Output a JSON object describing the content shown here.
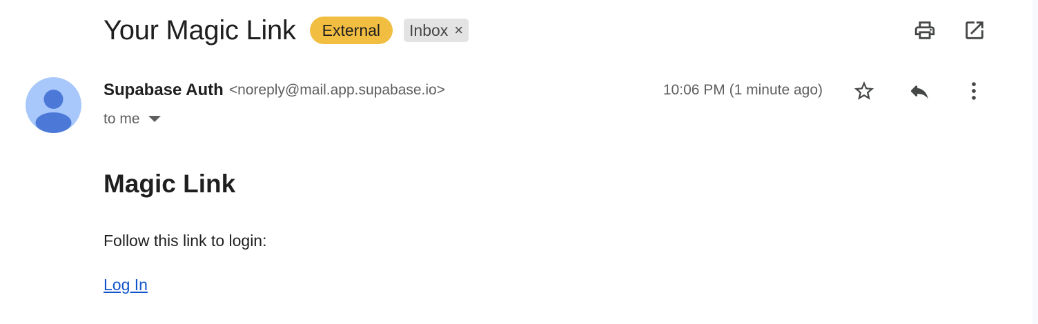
{
  "email": {
    "subject": "Your Magic Link",
    "labels": {
      "external": "External",
      "inbox": "Inbox",
      "remove_symbol": "×"
    },
    "sender": {
      "name": "Supabase Auth",
      "email": "<noreply@mail.app.supabase.io>"
    },
    "recipient_text": "to me",
    "timestamp": "10:06 PM (1 minute ago)",
    "body": {
      "heading": "Magic Link",
      "text": "Follow this link to login:",
      "link_text": "Log In"
    }
  },
  "icons": {
    "print": "print-icon",
    "open_new_window": "open-in-new-window-icon",
    "star": "star-icon",
    "reply": "reply-icon",
    "more": "more-vertical-icon",
    "avatar": "default-avatar-icon",
    "caret": "caret-down-icon"
  },
  "colors": {
    "external_badge": "#f2be42",
    "inbox_label": "#e3e3e3",
    "avatar_bg": "#a8c7fa",
    "avatar_fg": "#4c79d8",
    "link": "#1155cc"
  }
}
